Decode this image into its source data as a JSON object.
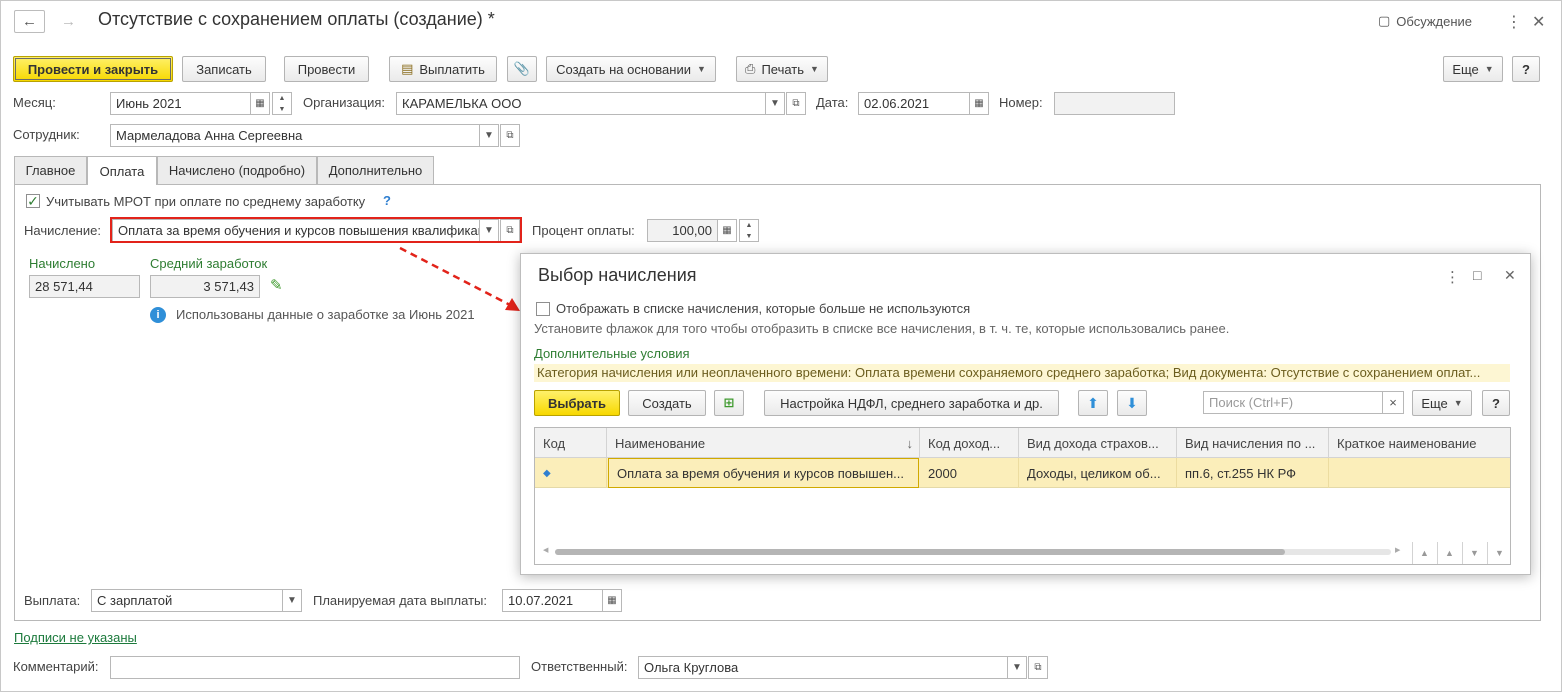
{
  "window": {
    "title": "Отсутствие с сохранением оплаты (создание) *",
    "discuss_label": "Обсуждение",
    "back_icon": "arrow-left-icon",
    "forward_icon": "arrow-right-icon"
  },
  "toolbar": {
    "post_close": "Провести и закрыть",
    "save": "Записать",
    "post": "Провести",
    "pay": "Выплатить",
    "create_based": "Создать на основании",
    "print": "Печать",
    "more": "Еще",
    "help": "?"
  },
  "header": {
    "month_label": "Месяц:",
    "month_value": "Июнь 2021",
    "org_label": "Организация:",
    "org_value": "КАРАМЕЛЬКА ООО",
    "date_label": "Дата:",
    "date_value": "02.06.2021",
    "number_label": "Номер:",
    "number_value": "",
    "employee_label": "Сотрудник:",
    "employee_value": "Мармеладова Анна Сергеевна"
  },
  "tabs": [
    {
      "label": "Главное"
    },
    {
      "label": "Оплата"
    },
    {
      "label": "Начислено (подробно)"
    },
    {
      "label": "Дополнительно"
    }
  ],
  "payment": {
    "mrot_checkbox_label": "Учитывать МРОТ при оплате по среднему заработку",
    "mrot_checked": true,
    "help_mark": "?",
    "accrual_label": "Начисление:",
    "accrual_value": "Оплата за время обучения и курсов повышения квалификации",
    "percent_label": "Процент оплаты:",
    "percent_value": "100,00",
    "accrued_head": "Начислено",
    "accrued_value": "28 571,44",
    "avg_head": "Средний заработок",
    "avg_value": "3 571,43",
    "info_text": "Использованы данные о заработке за Июнь 2021",
    "payout_label": "Выплата:",
    "payout_value": "С зарплатой",
    "plan_date_label": "Планируемая дата выплаты:",
    "plan_date_value": "10.07.2021"
  },
  "footer": {
    "signatures_link": "Подписи не указаны",
    "comment_label": "Комментарий:",
    "comment_value": "",
    "responsible_label": "Ответственный:",
    "responsible_value": "Ольга Круглова"
  },
  "dialog": {
    "title": "Выбор начисления",
    "show_unused_label": "Отображать в списке начисления, которые больше не используются",
    "show_unused_checked": false,
    "hint": "Установите флажок для того чтобы отобразить в списке все начисления, в т. ч. те, которые использовались ранее.",
    "extra_conditions_link": "Дополнительные условия",
    "conditions_text": "Категория начисления или неоплаченного времени: Оплата времени сохраняемого среднего заработка; Вид документа: Отсутствие с сохранением оплат...",
    "select_button": "Выбрать",
    "create_button": "Создать",
    "ndfl_button": "Настройка НДФЛ, среднего заработка и др.",
    "search_placeholder": "Поиск (Ctrl+F)",
    "search_clear": "×",
    "more": "Еще",
    "help": "?",
    "columns": [
      "Код",
      "Наименование",
      "Код доход...",
      "Вид дохода страхов...",
      "Вид начисления по ...",
      "Краткое наименование"
    ],
    "sort_mark": "↓",
    "rows": [
      {
        "code": "",
        "name": "Оплата за время обучения и курсов повышен...",
        "income_code": "2000",
        "insurance_income": "Доходы, целиком об...",
        "accrual_kind": "пп.6, ст.255 НК РФ",
        "short_name": ""
      }
    ]
  },
  "colors": {
    "primary_button": "#f7d800",
    "highlight_border": "#e2231a",
    "green_text": "#2e7d32",
    "selected_row": "#fbeeba"
  }
}
